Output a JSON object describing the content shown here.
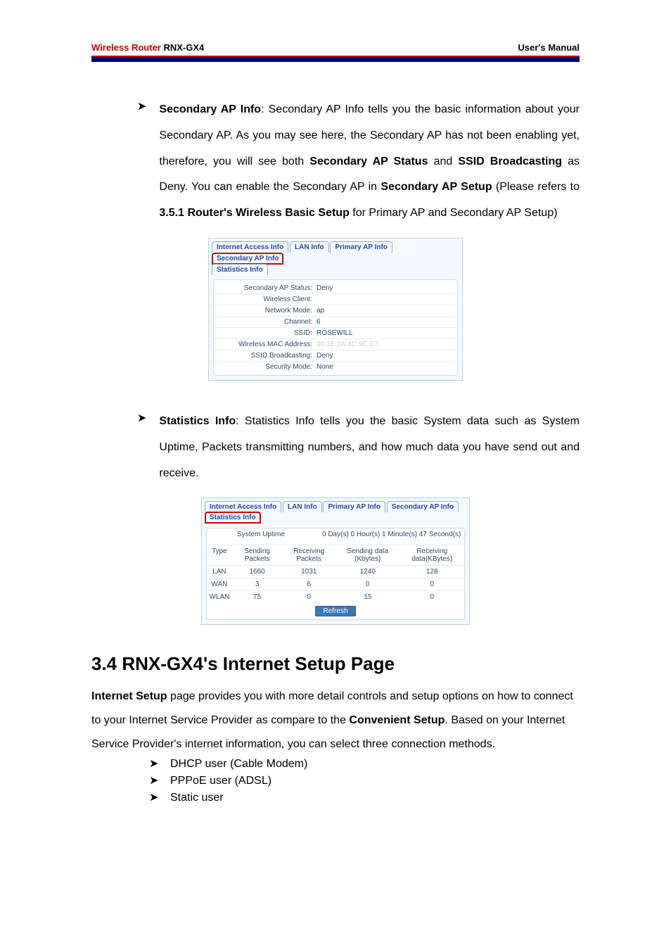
{
  "header": {
    "brand": "Wireless Router",
    "model": "RNX-GX4",
    "right": "User's Manual"
  },
  "para1": {
    "lead": "Secondary AP Info",
    "text1": ": Secondary AP Info tells you the basic information about your Secondary AP. As you may see here, the Secondary AP has not been enabling yet, therefore, you will see both ",
    "b1": "Secondary AP Status",
    "text2": " and ",
    "b2": "SSID Broadcasting",
    "text3": " as Deny. You can enable the Secondary AP in ",
    "b3": "Secondary AP Setup",
    "text4": " (Please refers to ",
    "b4": "3.5.1 Router's Wireless Basic Setup",
    "text5": " for Primary AP and Secondary AP Setup)"
  },
  "shot1": {
    "tabs": [
      "Internet Access Info",
      "LAN Info",
      "Primary AP Info",
      "Secondary AP Info"
    ],
    "tabs2": [
      "Statistics Info"
    ],
    "rows": [
      {
        "label": "Secondary AP Status:",
        "val": "Deny"
      },
      {
        "label": "Wireless Client:",
        "val": ""
      },
      {
        "label": "Network Mode:",
        "val": "ap"
      },
      {
        "label": "Channel:",
        "val": "6"
      },
      {
        "label": "SSID:",
        "val": "ROSEWILL"
      },
      {
        "label": "Wireless MAC Address:",
        "val": "00:1E:2A:4C:9C:C7"
      },
      {
        "label": "SSID Broadcasting:",
        "val": "Deny"
      },
      {
        "label": "Security Mode:",
        "val": "None"
      }
    ]
  },
  "para2": {
    "lead": "Statistics Info",
    "text": ": Statistics Info tells you the basic System data such as System Uptime, Packets transmitting numbers, and how much data you have send out and receive."
  },
  "shot2": {
    "tabs": [
      "Internet Access Info",
      "LAN Info",
      "Primary AP Info",
      "Secondary AP Info"
    ],
    "tabs2": [
      "Statistics Info"
    ],
    "uptime_label": "System Uptime",
    "uptime_val": "0 Day(s)  0 Hour(s)  1 Minute(s)  47 Second(s)",
    "headers": [
      "Type",
      "Sending Packets",
      "Receiving Packets",
      "Sending data (Kbytes)",
      "Receiving data(KBytes)"
    ],
    "data": [
      [
        "LAN",
        "1660",
        "1031",
        "1240",
        "128"
      ],
      [
        "WAN",
        "3",
        "6",
        "0",
        "0"
      ],
      [
        "WLAN",
        "75",
        "0",
        "15",
        "0"
      ]
    ],
    "refresh": "Refresh"
  },
  "section": {
    "title": "3.4 RNX-GX4's Internet Setup Page",
    "p_b1": "Internet Setup",
    "p_t1": " page provides you with more detail controls and setup options on how to connect to your Internet Service Provider as compare to the ",
    "p_b2": "Convenient Setup",
    "p_t2": ". Based on your Internet Service Provider's internet information, you can select three connection methods.",
    "list": [
      "DHCP user (Cable Modem)",
      "PPPoE user (ADSL)",
      "Static user"
    ]
  }
}
